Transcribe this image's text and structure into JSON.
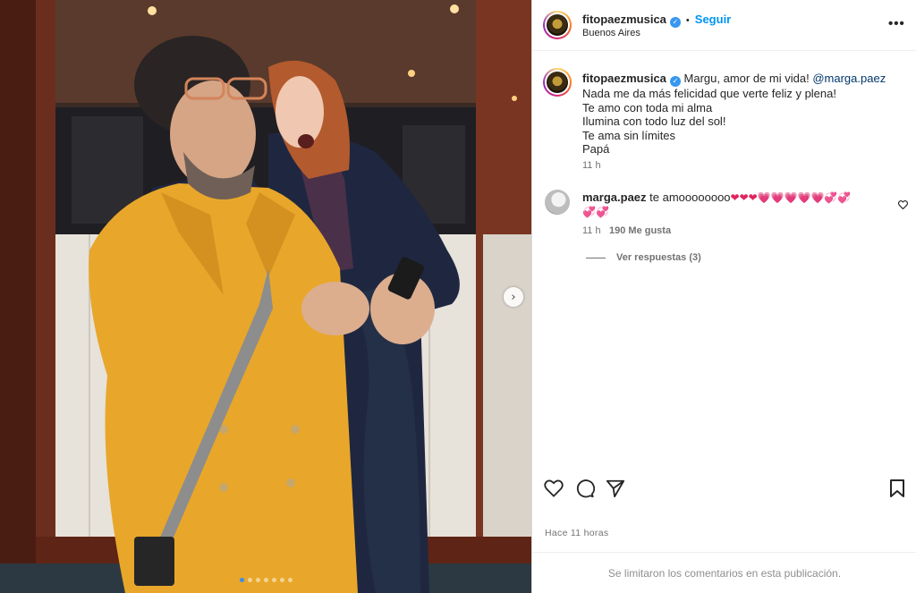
{
  "post": {
    "username": "fitopaezmusica",
    "follow_label": "Seguir",
    "separator": "•",
    "location": "Buenos Aires",
    "more_label": "•••"
  },
  "caption": {
    "username": "fitopaezmusica",
    "line1": "Margu, amor de mi vida!",
    "mention": "@marga.paez",
    "line2": "Nada me da más felicidad que verte feliz y plena!",
    "line3": "Te amo con toda mi alma",
    "line4": "Ilumina con todo luz del sol!",
    "line5": "Te ama sin límites",
    "line6": "Papá",
    "time": "11 h"
  },
  "comment": {
    "username": "marga.paez",
    "text": "te amoooooooo",
    "emojis_line1": "❤❤❤💗💗💗💗💗💞💞",
    "emojis_line2": "💞💞",
    "time": "11 h",
    "likes": "190 Me gusta",
    "replies_label": "Ver respuestas (3)"
  },
  "footer": {
    "timestamp": "Hace 11 horas",
    "comments_limited": "Se limitaron los comentarios en esta publicación."
  },
  "carousel": {
    "next_icon": "chevron-right-icon",
    "total_slides": 7,
    "active_slide": 1
  },
  "colors": {
    "accent": "#0095f6",
    "verified": "#3897f0",
    "heart": "#e0245e",
    "pink_heart": "#e75aa8"
  }
}
